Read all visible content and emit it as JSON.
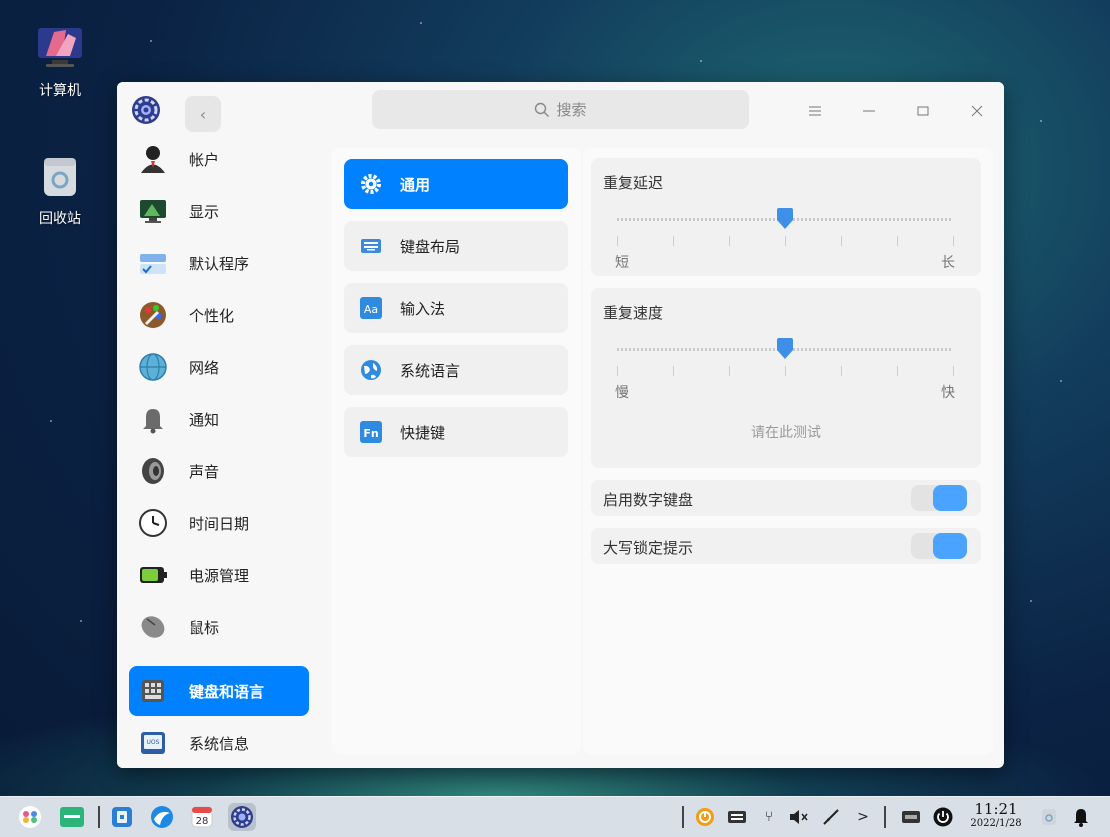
{
  "desktop": {
    "icons": [
      {
        "label": "计算机",
        "icon": "computer-icon"
      },
      {
        "label": "回收站",
        "icon": "trash-icon"
      }
    ]
  },
  "window": {
    "search_placeholder": "搜索",
    "sidebar": {
      "items": [
        {
          "label": "帐户",
          "icon": "account-icon"
        },
        {
          "label": "显示",
          "icon": "display-icon"
        },
        {
          "label": "默认程序",
          "icon": "default-apps-icon"
        },
        {
          "label": "个性化",
          "icon": "personalization-icon"
        },
        {
          "label": "网络",
          "icon": "network-icon"
        },
        {
          "label": "通知",
          "icon": "notification-bell-icon"
        },
        {
          "label": "声音",
          "icon": "speaker-icon"
        },
        {
          "label": "时间日期",
          "icon": "clock-icon"
        },
        {
          "label": "电源管理",
          "icon": "battery-icon"
        },
        {
          "label": "鼠标",
          "icon": "mouse-icon"
        },
        {
          "label": "键盘和语言",
          "icon": "keyboard-icon",
          "active": true
        },
        {
          "label": "系统信息",
          "icon": "system-info-icon"
        }
      ]
    },
    "middle": {
      "items": [
        {
          "label": "通用",
          "icon": "gear-icon",
          "active": true
        },
        {
          "label": "键盘布局",
          "icon": "keyboard-layout-icon"
        },
        {
          "label": "输入法",
          "icon": "input-method-icon",
          "badge": "Aa"
        },
        {
          "label": "系统语言",
          "icon": "globe-icon"
        },
        {
          "label": "快捷键",
          "icon": "shortcut-icon",
          "badge": "Fn"
        }
      ]
    },
    "general": {
      "repeat_delay": {
        "title": "重复延迟",
        "min_label": "短",
        "max_label": "长",
        "value": 0.5
      },
      "repeat_rate": {
        "title": "重复速度",
        "min_label": "慢",
        "max_label": "快",
        "value": 0.5,
        "test_placeholder": "请在此测试"
      },
      "numlock": {
        "label": "启用数字键盘",
        "enabled": true
      },
      "capslock": {
        "label": "大写锁定提示",
        "enabled": true
      }
    }
  },
  "taskbar": {
    "time": "11:21",
    "date": "2022/1/28",
    "calendar_day": "28"
  },
  "colors": {
    "accent": "#0081ff",
    "toggle_on": "#4aa3ff"
  }
}
